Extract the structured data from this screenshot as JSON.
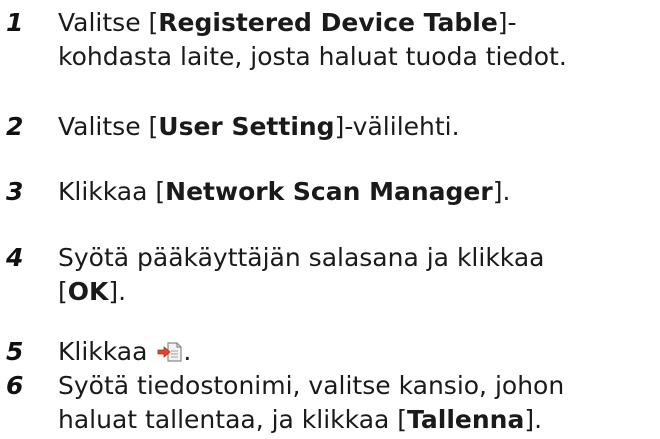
{
  "steps": [
    {
      "number": "1",
      "lines": [
        {
          "before": "Valitse [",
          "bold": "Registered Device Table",
          "after": "]-"
        },
        {
          "before": "kohdasta laite, josta haluat tuoda tiedot.",
          "bold": "",
          "after": ""
        }
      ]
    },
    {
      "number": "2",
      "lines": [
        {
          "before": "Valitse [",
          "bold": "User Setting",
          "after": "]-välilehti."
        }
      ]
    },
    {
      "number": "3",
      "lines": [
        {
          "before": "Klikkaa [",
          "bold": "Network Scan Manager",
          "after": "]."
        }
      ]
    },
    {
      "number": "4",
      "lines": [
        {
          "before": "Syötä pääkäyttäjän salasana ja klikkaa",
          "bold": "",
          "after": ""
        },
        {
          "before": "[",
          "bold": "OK",
          "after": "]."
        }
      ]
    },
    {
      "number": "5",
      "lines": [
        {
          "before": "Klikkaa ",
          "bold": "",
          "after": "."
        }
      ],
      "icon": "import-file-icon"
    },
    {
      "number": "6",
      "lines": [
        {
          "before": "Syötä tiedostonimi, valitse kansio, johon",
          "bold": "",
          "after": ""
        },
        {
          "before": "haluat tallentaa, ja klikkaa [",
          "bold": "Tallenna",
          "after": "]."
        }
      ]
    }
  ]
}
